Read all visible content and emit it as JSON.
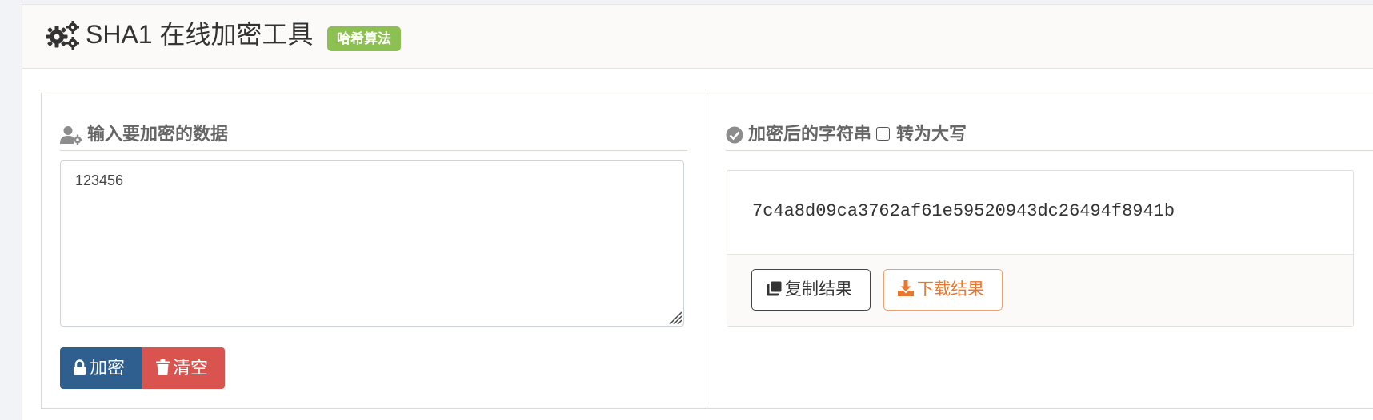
{
  "header": {
    "title": "SHA1 在线加密工具",
    "badge": "哈希算法",
    "icon": "gears-icon"
  },
  "input_panel": {
    "title": "输入要加密的数据",
    "icon": "user-gear-icon",
    "value": "123456",
    "encrypt_label": "加密",
    "encrypt_icon": "lock-icon",
    "clear_label": "清空",
    "clear_icon": "trash-icon"
  },
  "output_panel": {
    "title": "加密后的字符串",
    "icon": "check-circle-icon",
    "uppercase_label": "转为大写",
    "uppercase_checked": false,
    "result": "7c4a8d09ca3762af61e59520943dc26494f8941b",
    "copy_label": "复制结果",
    "copy_icon": "clone-icon",
    "download_label": "下载结果",
    "download_icon": "download-icon"
  },
  "colors": {
    "badge": "#8cc152",
    "encrypt_button": "#2e5f8e",
    "clear_button": "#d9534f",
    "download_accent": "#e9772f"
  }
}
